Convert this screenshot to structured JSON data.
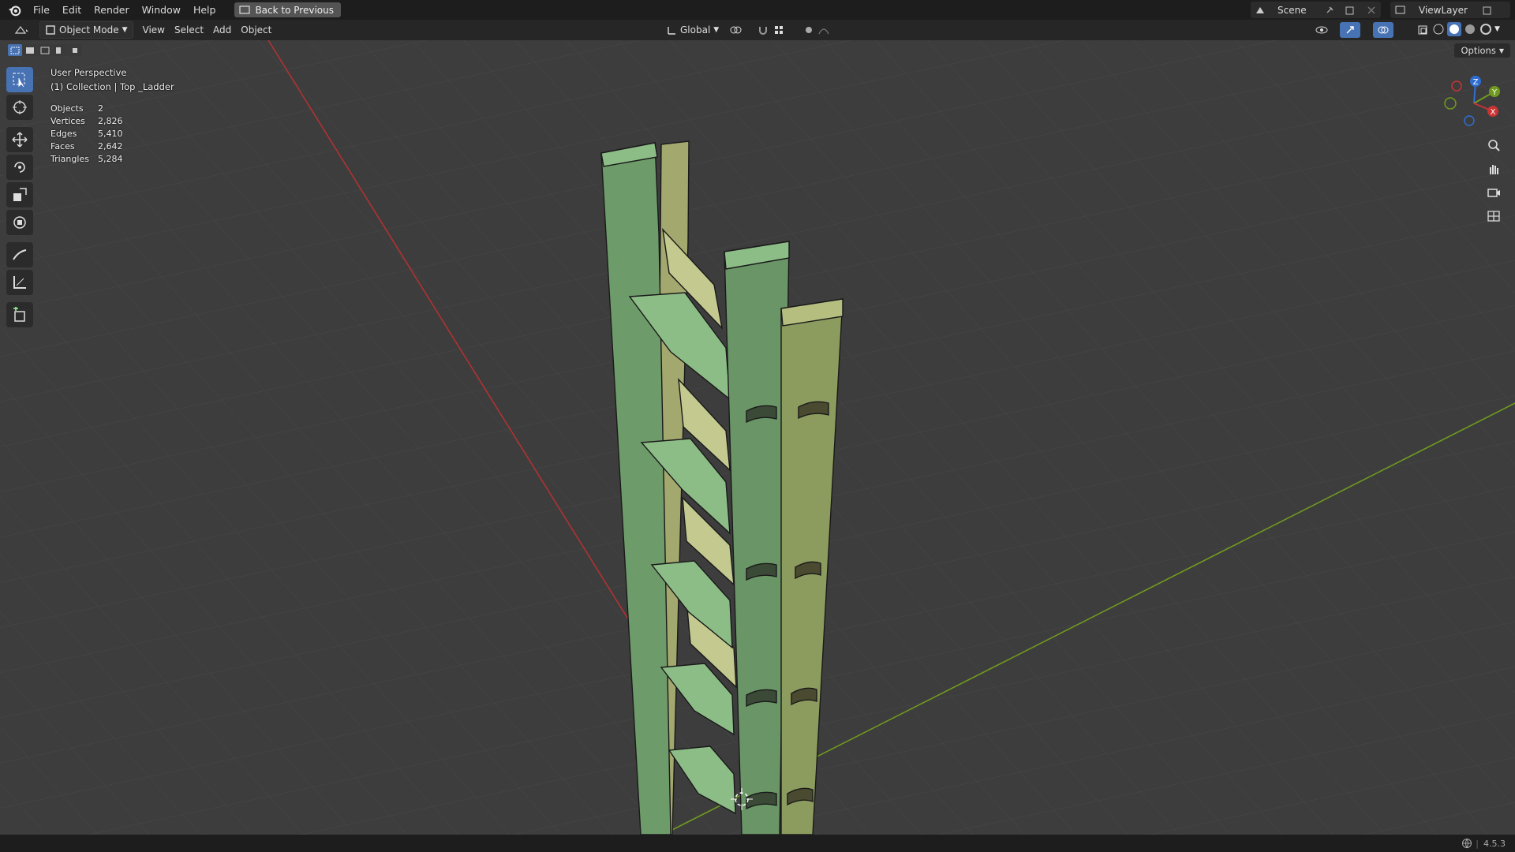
{
  "menu": {
    "items": [
      "File",
      "Edit",
      "Render",
      "Window",
      "Help"
    ],
    "back_button": "Back to Previous"
  },
  "scene": {
    "name": "Scene",
    "view_layer": "ViewLayer"
  },
  "header": {
    "mode": "Object Mode",
    "view": "View",
    "select": "Select",
    "add": "Add",
    "object": "Object",
    "orientation": "Global",
    "options": "Options"
  },
  "viewport": {
    "perspective": "User Perspective",
    "collection": "(1) Collection | Top _Ladder",
    "stats": [
      {
        "label": "Objects",
        "value": "2"
      },
      {
        "label": "Vertices",
        "value": "2,826"
      },
      {
        "label": "Edges",
        "value": "5,410"
      },
      {
        "label": "Faces",
        "value": "2,642"
      },
      {
        "label": "Triangles",
        "value": "5,284"
      }
    ],
    "gizmo_axes": [
      "Z",
      "Y",
      "X"
    ]
  },
  "toolbar": {
    "tools": [
      "select-box-icon",
      "cursor-icon",
      "move-icon",
      "rotate-icon",
      "scale-icon",
      "transform-icon",
      "annotate-icon",
      "measure-icon",
      "add-cube-icon"
    ]
  },
  "status": {
    "version": "4.5.3"
  },
  "colors": {
    "accent": "#4772b3",
    "x_axis": "#c83434",
    "y_axis": "#6f9a1f",
    "ladder": "#6e9b6a"
  }
}
